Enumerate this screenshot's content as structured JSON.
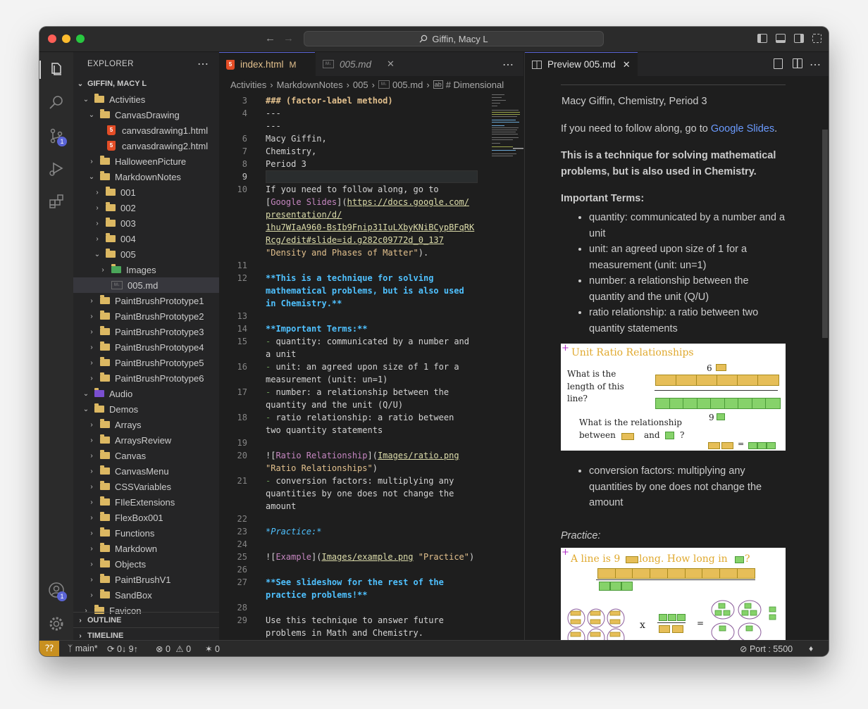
{
  "window": {
    "title": "Giffin, Macy L"
  },
  "explorer": {
    "title": "EXPLORER",
    "folder": "GIFFIN, MACY L",
    "outline": "OUTLINE",
    "timeline": "TIMELINE"
  },
  "tree": [
    {
      "label": "Activities",
      "type": "folder",
      "depth": 1,
      "open": true
    },
    {
      "label": "CanvasDrawing",
      "type": "folder",
      "depth": 2,
      "open": true
    },
    {
      "label": "canvasdrawing1.html",
      "type": "html",
      "depth": 3
    },
    {
      "label": "canvasdrawing2.html",
      "type": "html",
      "depth": 3
    },
    {
      "label": "HalloweenPicture",
      "type": "folder",
      "depth": 2,
      "open": false
    },
    {
      "label": "MarkdownNotes",
      "type": "folder",
      "depth": 2,
      "open": true
    },
    {
      "label": "001",
      "type": "folder",
      "depth": 3,
      "open": false
    },
    {
      "label": "002",
      "type": "folder",
      "depth": 3,
      "open": false
    },
    {
      "label": "003",
      "type": "folder",
      "depth": 3,
      "open": false
    },
    {
      "label": "004",
      "type": "folder",
      "depth": 3,
      "open": false
    },
    {
      "label": "005",
      "type": "folder",
      "depth": 3,
      "open": true
    },
    {
      "label": "Images",
      "type": "imgfolder",
      "depth": 4,
      "open": false
    },
    {
      "label": "005.md",
      "type": "md",
      "depth": 4,
      "selected": true
    },
    {
      "label": "PaintBrushPrototype1",
      "type": "folder",
      "depth": 2,
      "open": false
    },
    {
      "label": "PaintBrushPrototype2",
      "type": "folder",
      "depth": 2,
      "open": false
    },
    {
      "label": "PaintBrushPrototype3",
      "type": "folder",
      "depth": 2,
      "open": false
    },
    {
      "label": "PaintBrushPrototype4",
      "type": "folder",
      "depth": 2,
      "open": false
    },
    {
      "label": "PaintBrushPrototype5",
      "type": "folder",
      "depth": 2,
      "open": false
    },
    {
      "label": "PaintBrushPrototype6",
      "type": "folder",
      "depth": 2,
      "open": false
    },
    {
      "label": "Audio",
      "type": "audio",
      "depth": 1,
      "open": true
    },
    {
      "label": "Demos",
      "type": "folder",
      "depth": 1,
      "open": true
    },
    {
      "label": "Arrays",
      "type": "folder",
      "depth": 2,
      "open": false
    },
    {
      "label": "ArraysReview",
      "type": "folder",
      "depth": 2,
      "open": false
    },
    {
      "label": "Canvas",
      "type": "folder",
      "depth": 2,
      "open": false
    },
    {
      "label": "CanvasMenu",
      "type": "folder",
      "depth": 2,
      "open": false
    },
    {
      "label": "CSSVariables",
      "type": "folder",
      "depth": 2,
      "open": false
    },
    {
      "label": "FIleExtensions",
      "type": "folder",
      "depth": 2,
      "open": false
    },
    {
      "label": "FlexBox001",
      "type": "folder",
      "depth": 2,
      "open": false
    },
    {
      "label": "Functions",
      "type": "folder",
      "depth": 2,
      "open": false
    },
    {
      "label": "Markdown",
      "type": "folder",
      "depth": 2,
      "open": false
    },
    {
      "label": "Objects",
      "type": "folder",
      "depth": 2,
      "open": false
    },
    {
      "label": "PaintBrushV1",
      "type": "folder",
      "depth": 2,
      "open": false
    },
    {
      "label": "SandBox",
      "type": "folder",
      "depth": 2,
      "open": false
    },
    {
      "label": "Favicon",
      "type": "folder",
      "depth": 1,
      "open": false
    }
  ],
  "tabs": [
    {
      "label": "index.html",
      "badge": "M",
      "active": true
    },
    {
      "label": "005.md",
      "active": false
    }
  ],
  "breadcrumbs": [
    "Activities",
    "MarkdownNotes",
    "005",
    "005.md",
    "# Dimensional"
  ],
  "code": [
    {
      "n": "3",
      "segs": [
        {
          "t": "### (factor-label method)",
          "c": "h"
        }
      ]
    },
    {
      "n": "4",
      "segs": [
        {
          "t": "---",
          "c": "t"
        }
      ]
    },
    {
      "n": "",
      "segs": [
        {
          "t": "---",
          "c": "t"
        }
      ]
    },
    {
      "n": "6",
      "segs": [
        {
          "t": "Macy Giffin,",
          "c": "t"
        }
      ]
    },
    {
      "n": "7",
      "segs": [
        {
          "t": "Chemistry,",
          "c": "t"
        }
      ]
    },
    {
      "n": "8",
      "segs": [
        {
          "t": "Period 3",
          "c": "t"
        }
      ]
    },
    {
      "n": "9",
      "segs": [],
      "current": true
    },
    {
      "n": "10",
      "segs": [
        {
          "t": "If you need to follow along, go to",
          "c": "t"
        }
      ]
    },
    {
      "n": "",
      "segs": [
        {
          "t": "[",
          "c": "t"
        },
        {
          "t": "Google Slides",
          "c": "lt"
        },
        {
          "t": "](",
          "c": "t"
        },
        {
          "t": "https://docs.google.com/",
          "c": "url"
        }
      ]
    },
    {
      "n": "",
      "segs": [
        {
          "t": "presentation/d/",
          "c": "url"
        }
      ]
    },
    {
      "n": "",
      "segs": [
        {
          "t": "1hu7WIaA960-BsIb9Fnip31IuLXbyKNiBCypBFqRK",
          "c": "url"
        }
      ]
    },
    {
      "n": "",
      "segs": [
        {
          "t": "Rcg/edit#slide=id.g282c09772d_0_137",
          "c": "url"
        }
      ]
    },
    {
      "n": "",
      "segs": [
        {
          "t": "\"Density and Phases of Matter\"",
          "c": "str"
        },
        {
          "t": ").",
          "c": "t"
        }
      ]
    },
    {
      "n": "11",
      "segs": []
    },
    {
      "n": "12",
      "segs": [
        {
          "t": "**This is a technique for solving",
          "c": "b"
        }
      ]
    },
    {
      "n": "",
      "segs": [
        {
          "t": "mathematical problems, but is also used",
          "c": "b"
        }
      ]
    },
    {
      "n": "",
      "segs": [
        {
          "t": "in Chemistry.**",
          "c": "b"
        }
      ]
    },
    {
      "n": "13",
      "segs": []
    },
    {
      "n": "14",
      "segs": [
        {
          "t": "**Important Terms:**",
          "c": "b"
        }
      ]
    },
    {
      "n": "15",
      "segs": [
        {
          "t": "- ",
          "c": "dash"
        },
        {
          "t": "quantity: communicated by a number and",
          "c": "t"
        }
      ]
    },
    {
      "n": "",
      "segs": [
        {
          "t": "a unit",
          "c": "t"
        }
      ]
    },
    {
      "n": "16",
      "segs": [
        {
          "t": "- ",
          "c": "dash"
        },
        {
          "t": "unit: an agreed upon size of 1 for a",
          "c": "t"
        }
      ]
    },
    {
      "n": "",
      "segs": [
        {
          "t": "measurement (unit: un=1)",
          "c": "t"
        }
      ]
    },
    {
      "n": "17",
      "segs": [
        {
          "t": "- ",
          "c": "dash"
        },
        {
          "t": "number: a relationship between the",
          "c": "t"
        }
      ]
    },
    {
      "n": "",
      "segs": [
        {
          "t": "quantity and the unit (Q/U)",
          "c": "t"
        }
      ]
    },
    {
      "n": "18",
      "segs": [
        {
          "t": "- ",
          "c": "dash"
        },
        {
          "t": "ratio relationship: a ratio between",
          "c": "t"
        }
      ]
    },
    {
      "n": "",
      "segs": [
        {
          "t": "two quantity statements",
          "c": "t"
        }
      ]
    },
    {
      "n": "19",
      "segs": []
    },
    {
      "n": "20",
      "segs": [
        {
          "t": "![",
          "c": "t"
        },
        {
          "t": "Ratio Relationship",
          "c": "lt"
        },
        {
          "t": "](",
          "c": "t"
        },
        {
          "t": "Images/ratio.png",
          "c": "url"
        }
      ]
    },
    {
      "n": "",
      "segs": [
        {
          "t": "\"Ratio Relationships\"",
          "c": "str"
        },
        {
          "t": ")",
          "c": "t"
        }
      ]
    },
    {
      "n": "21",
      "segs": [
        {
          "t": "- ",
          "c": "dash"
        },
        {
          "t": "conversion factors: multiplying any",
          "c": "t"
        }
      ]
    },
    {
      "n": "",
      "segs": [
        {
          "t": "quantities by one does not change the",
          "c": "t"
        }
      ]
    },
    {
      "n": "",
      "segs": [
        {
          "t": "amount",
          "c": "t"
        }
      ]
    },
    {
      "n": "22",
      "segs": []
    },
    {
      "n": "23",
      "segs": [
        {
          "t": "*Practice:*",
          "c": "i"
        }
      ]
    },
    {
      "n": "24",
      "segs": []
    },
    {
      "n": "25",
      "segs": [
        {
          "t": "![",
          "c": "t"
        },
        {
          "t": "Example",
          "c": "lt"
        },
        {
          "t": "](",
          "c": "t"
        },
        {
          "t": "Images/example.png",
          "c": "url"
        },
        {
          "t": " \"Practice\"",
          "c": "str"
        },
        {
          "t": ")",
          "c": "t"
        }
      ]
    },
    {
      "n": "26",
      "segs": []
    },
    {
      "n": "27",
      "segs": [
        {
          "t": "**See slideshow for the rest of the",
          "c": "b"
        }
      ]
    },
    {
      "n": "",
      "segs": [
        {
          "t": "practice problems!**",
          "c": "b"
        }
      ]
    },
    {
      "n": "28",
      "segs": []
    },
    {
      "n": "29",
      "segs": [
        {
          "t": "Use this technique to answer future",
          "c": "t"
        }
      ]
    },
    {
      "n": "",
      "segs": [
        {
          "t": "problems in Math and Chemistry.",
          "c": "t"
        }
      ]
    },
    {
      "n": "30",
      "segs": []
    }
  ],
  "preview": {
    "tab": "Preview 005.md",
    "quote": "Macy Giffin, Chemistry, Period 3",
    "follow_prefix": "If you need to follow along, go to ",
    "follow_link": "Google Slides",
    "follow_suffix": ".",
    "bold_para": "This is a technique for solving mathematical problems, but is also used in Chemistry.",
    "terms_heading": "Important Terms:",
    "terms": [
      "quantity: communicated by a number and a unit",
      "unit: an agreed upon size of 1 for a measurement (unit: un=1)",
      "number: a relationship between the quantity and the unit (Q/U)",
      "ratio relationship: a ratio between two quantity statements"
    ],
    "ratio_img": {
      "title": "Unit Ratio Relationships",
      "q1": "What is the length of this line?",
      "num1": "6",
      "q2": "What is the relationship between",
      "and": "and",
      "qmark": "?",
      "num2": "9",
      "eq": "="
    },
    "conversion": "conversion factors: multiplying any quantities by one does not change the amount",
    "practice": "Practice:",
    "example_img": {
      "title": "A line is 9",
      "title2": "long.  How long in",
      "qmark": "?",
      "x": "x",
      "eq": "="
    }
  },
  "status": {
    "branch": "main*",
    "sync": "0↓ 9↑",
    "errors": "0",
    "warnings": "0",
    "ports": "0",
    "live": "Port : 5500"
  },
  "colors": {
    "accent": "#5a64d6",
    "folder": "#dcb862",
    "link": "#6b9bff",
    "heading": "#569cd6"
  }
}
